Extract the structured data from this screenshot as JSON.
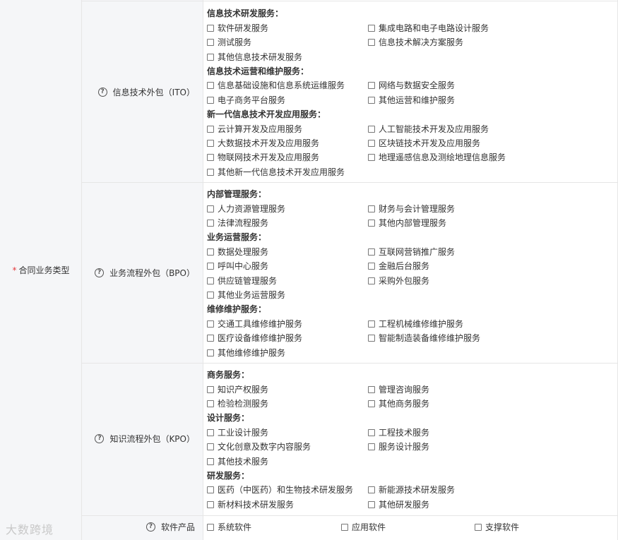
{
  "main_label": {
    "required_mark": "*",
    "text": "合同业务类型"
  },
  "sections": [
    {
      "label": "信息技术外包（ITO）",
      "groups": [
        {
          "title": "信息技术研发服务：",
          "options": [
            "软件研发服务",
            "集成电路和电子电路设计服务",
            "测试服务",
            "信息技术解决方案服务",
            "其他信息技术研发服务"
          ]
        },
        {
          "title": "信息技术运营和维护服务：",
          "options": [
            "信息基础设施和信息系统运维服务",
            "网络与数据安全服务",
            "电子商务平台服务",
            "其他运营和维护服务"
          ]
        },
        {
          "title": "新一代信息技术开发应用服务：",
          "options": [
            "云计算开发及应用服务",
            "人工智能技术开发及应用服务",
            "大数据技术开发及应用服务",
            "区块链技术开发及应用服务",
            "物联网技术开发及应用服务",
            "地理遥感信息及测绘地理信息服务",
            "其他新一代信息技术开发应用服务"
          ]
        }
      ]
    },
    {
      "label": "业务流程外包（BPO）",
      "groups": [
        {
          "title": "内部管理服务：",
          "options": [
            "人力资源管理服务",
            "财务与会计管理服务",
            "法律流程服务",
            "其他内部管理服务"
          ]
        },
        {
          "title": "业务运营服务：",
          "options": [
            "数据处理服务",
            "互联网营销推广服务",
            "呼叫中心服务",
            "金融后台服务",
            "供应链管理服务",
            "采购外包服务",
            "其他业务运营服务"
          ]
        },
        {
          "title": "维修维护服务：",
          "options": [
            "交通工具维修维护服务",
            "工程机械维修维护服务",
            "医疗设备维修维护服务",
            "智能制造装备维修维护服务",
            "其他维修维护服务"
          ]
        }
      ]
    },
    {
      "label": "知识流程外包（KPO）",
      "groups": [
        {
          "title": "商务服务：",
          "options": [
            "知识产权服务",
            "管理咨询服务",
            "检验检测服务",
            "其他商务服务"
          ]
        },
        {
          "title": "设计服务：",
          "options": [
            "工业设计服务",
            "工程技术服务",
            "文化创意及数字内容服务",
            "服务设计服务",
            "其他技术服务"
          ]
        },
        {
          "title": "研发服务：",
          "options": [
            "医药（中医药）和生物技术研发服务",
            "新能源技术研发服务",
            "新材料技术研发服务",
            "其他研发服务"
          ]
        }
      ]
    }
  ],
  "software": {
    "label": "软件产品",
    "options": [
      "系统软件",
      "应用软件",
      "支撑软件"
    ]
  },
  "help_icon_glyph": "?",
  "watermark": "大数跨境"
}
